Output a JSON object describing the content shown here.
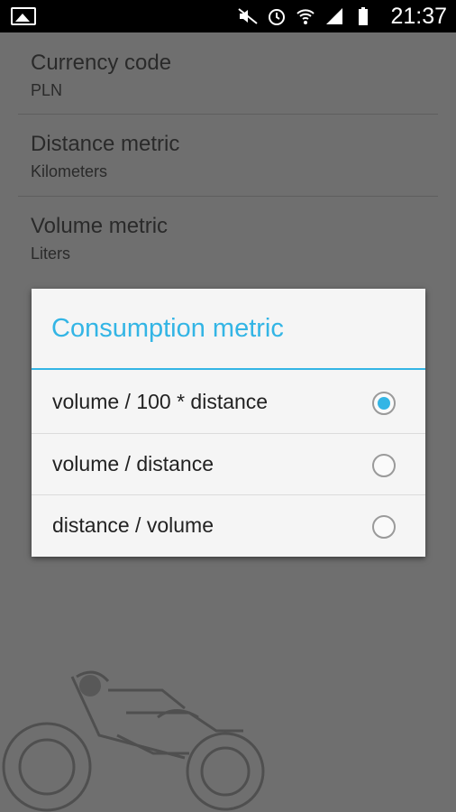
{
  "status_bar": {
    "time": "21:37",
    "icons": [
      "notification-image-icon",
      "mute-icon",
      "alarm-icon",
      "wifi-icon",
      "signal-icon",
      "battery-icon"
    ]
  },
  "settings": {
    "items": [
      {
        "title": "Currency code",
        "summary": "PLN"
      },
      {
        "title": "Distance metric",
        "summary": "Kilometers"
      },
      {
        "title": "Volume metric",
        "summary": "Liters"
      }
    ]
  },
  "dialog": {
    "title": "Consumption metric",
    "accent_color": "#33b5e5",
    "options": [
      {
        "label": "volume / 100 * distance",
        "selected": true
      },
      {
        "label": "volume / distance",
        "selected": false
      },
      {
        "label": "distance / volume",
        "selected": false
      }
    ]
  }
}
